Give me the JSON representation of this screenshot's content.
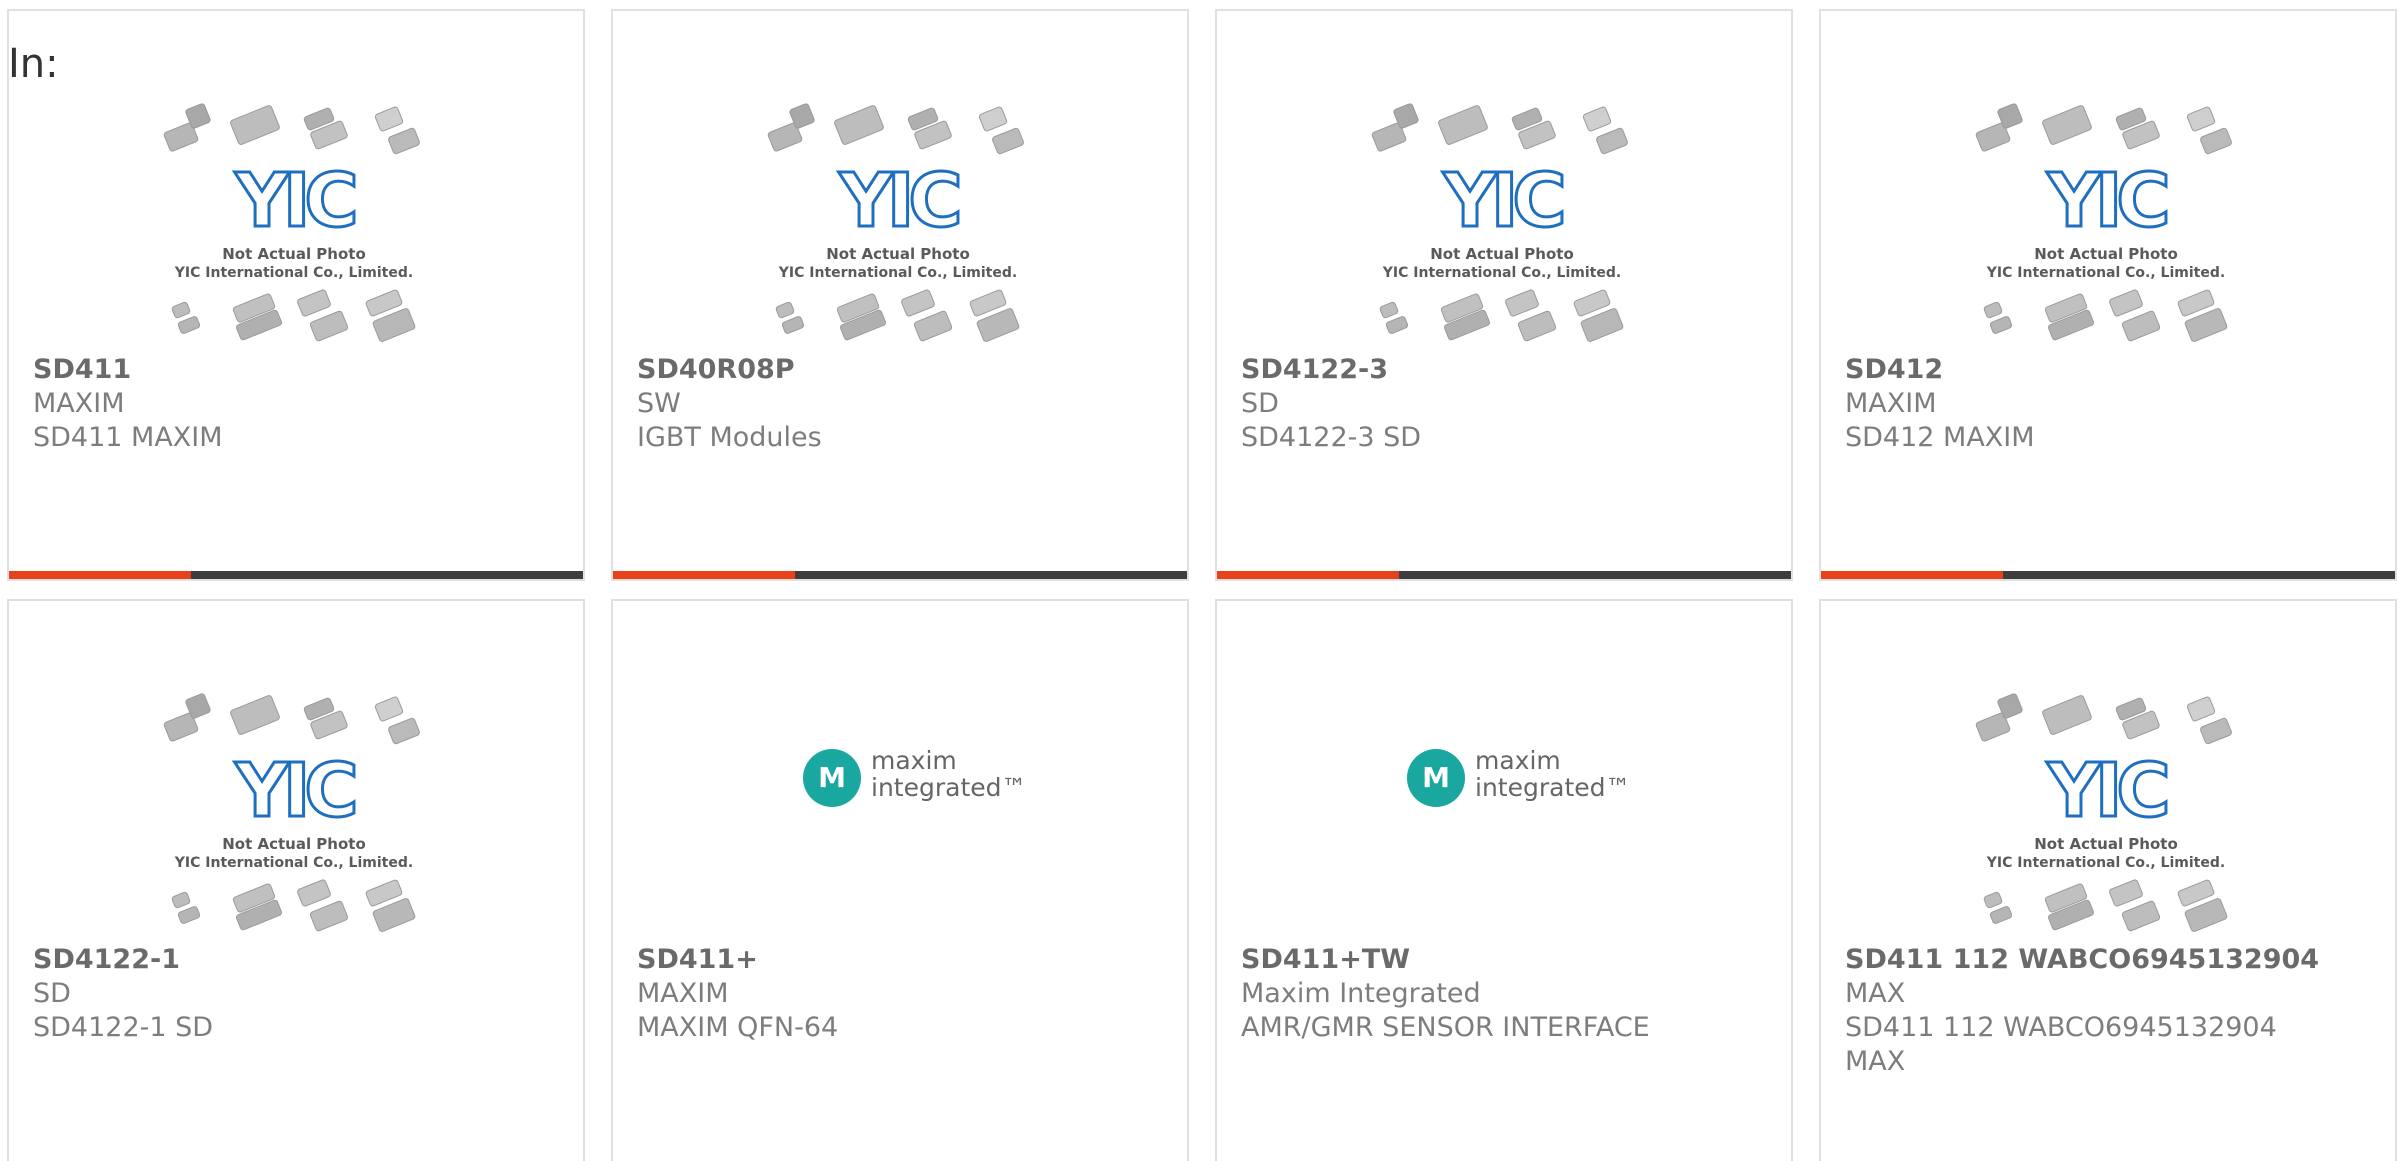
{
  "header": {
    "label": "In:"
  },
  "thumb_text": {
    "yic_logo": "YIC",
    "not_actual": "Not Actual Photo",
    "company": "YIC International Co., Limited."
  },
  "maxim_logo": {
    "glyph": "M",
    "line1": "maxim",
    "line2": "integrated™"
  },
  "colors": {
    "accent": "#e8421b",
    "bar": "#3d3d3d",
    "yic_blue": "#1f6fc0",
    "maxim_teal": "#1aa7a0"
  },
  "products": [
    {
      "part": "SD411",
      "mfr": "MAXIM",
      "desc": "SD411 MAXIM",
      "desc2": "",
      "image": "yic-placeholder"
    },
    {
      "part": "SD40R08P",
      "mfr": "SW",
      "desc": "IGBT Modules",
      "desc2": "",
      "image": "yic-placeholder"
    },
    {
      "part": "SD4122-3",
      "mfr": "SD",
      "desc": "SD4122-3 SD",
      "desc2": "",
      "image": "yic-placeholder"
    },
    {
      "part": "SD412",
      "mfr": "MAXIM",
      "desc": "SD412 MAXIM",
      "desc2": "",
      "image": "yic-placeholder"
    },
    {
      "part": "SD4122-1",
      "mfr": "SD",
      "desc": "SD4122-1 SD",
      "desc2": "",
      "image": "yic-placeholder"
    },
    {
      "part": "SD411+",
      "mfr": "MAXIM",
      "desc": "MAXIM QFN-64",
      "desc2": "",
      "image": "maxim-logo"
    },
    {
      "part": "SD411+TW",
      "mfr": "Maxim Integrated",
      "desc": "AMR/GMR SENSOR INTERFACE",
      "desc2": "",
      "image": "maxim-logo"
    },
    {
      "part": "SD411 112 WABCO6945132904",
      "mfr": "MAX",
      "desc": "SD411 112 WABCO6945132904",
      "desc2": "MAX",
      "image": "yic-placeholder"
    }
  ]
}
